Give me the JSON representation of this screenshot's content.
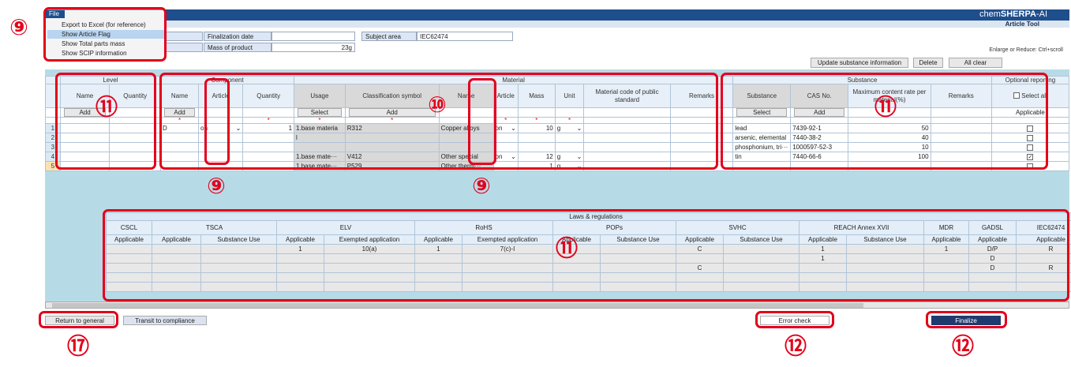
{
  "menu": {
    "file_label": "File",
    "items": [
      "Export to Excel (for reference)",
      "Show Article Flag",
      "Show Total parts mass",
      "Show SCIP information"
    ],
    "highlighted_index": 1
  },
  "header": {
    "logo": "chemSHERPA-AI",
    "logo_prefix": "chem",
    "logo_main": "SHERPA",
    "logo_suffix": "-AI",
    "tool_title": "Article Tool",
    "finalization_date_label": "Finalization date",
    "finalization_date_value": "",
    "subject_area_label": "Subject area",
    "subject_area_value": "IEC62474",
    "mass_label": "Mass of product",
    "mass_value": "23g",
    "enlarge_hint": "Enlarge or Reduce: Ctrl+scroll"
  },
  "toolbar": {
    "update_label": "Update substance information",
    "delete_label": "Delete",
    "allclear_label": "All clear"
  },
  "grid": {
    "group_headers": {
      "level": "Level",
      "component": "Component",
      "material": "Material",
      "substance": "Substance",
      "optional": "Optional reporting"
    },
    "columns": {
      "level_name": "Name",
      "level_qty": "Quantity",
      "comp_name": "Name",
      "comp_article": "Article",
      "comp_qty": "Quantity",
      "usage": "Usage",
      "class_symbol": "Classification symbol",
      "mat_name": "Name",
      "mat_article": "Article",
      "mass": "Mass",
      "unit": "Unit",
      "mat_code": "Material code of public standard",
      "mat_remarks": "Remarks",
      "substance": "Substance",
      "cas": "CAS No.",
      "max_rate": "Maximum content rate per material(%)",
      "sub_remarks": "Remarks",
      "select_all": "Select all"
    },
    "buttons": {
      "add": "Add",
      "select": "Select",
      "applicable": "Applicable"
    },
    "rows": [
      {
        "num": "1",
        "comp_name": "D",
        "comp_article": "on",
        "comp_qty": "1",
        "usage": "1.base materia",
        "class": "R312",
        "mat_name": "Copper alloys",
        "mat_article": "on",
        "mass": "10",
        "unit": "g",
        "substance": "lead",
        "cas": "7439-92-1",
        "rate": "50",
        "checked": false
      },
      {
        "num": "2",
        "comp_name": "",
        "comp_article": "",
        "comp_qty": "",
        "usage": "l",
        "class": "",
        "mat_name": "",
        "mat_article": "",
        "mass": "",
        "unit": "",
        "substance": "arsenic, elemental",
        "cas": "7440-38-2",
        "rate": "40",
        "checked": false
      },
      {
        "num": "3",
        "comp_name": "",
        "comp_article": "",
        "comp_qty": "",
        "usage": "",
        "class": "",
        "mat_name": "",
        "mat_article": "",
        "mass": "",
        "unit": "",
        "substance": "phosphonium, tri···",
        "cas": "1000597-52-3",
        "rate": "10",
        "checked": false
      },
      {
        "num": "4",
        "comp_name": "",
        "comp_article": "",
        "comp_qty": "",
        "usage": "1.base mate···",
        "class": "V412",
        "mat_name": "Other special",
        "mat_article": "on",
        "mass": "12",
        "unit": "g",
        "substance": "tin",
        "cas": "7440-66-6",
        "rate": "100",
        "checked": true
      },
      {
        "num": "5",
        "comp_name": "",
        "comp_article": "",
        "comp_qty": "",
        "usage": "1.base mate···",
        "class": "P529",
        "mat_name": "Other therm···",
        "mat_article": "",
        "mass": "1",
        "unit": "g",
        "substance": "",
        "cas": "",
        "rate": "",
        "checked": false
      }
    ]
  },
  "laws": {
    "title": "Laws & regulations",
    "groups": [
      "CSCL",
      "TSCA",
      "ELV",
      "RoHS",
      "POPs",
      "SVHC",
      "REACH Annex XVII",
      "MDR",
      "GADSL",
      "IEC62474"
    ],
    "subheaders": [
      "Applicable",
      "Applicable",
      "Substance Use",
      "Applicable",
      "Exempted application",
      "Applicable",
      "Exempted application",
      "Applicable",
      "Substance Use",
      "Applicable",
      "Substance Use",
      "Applicable",
      "Substance Use",
      "Applicable",
      "Applicable",
      "Applicable"
    ],
    "rows": [
      [
        "",
        "",
        "",
        "1",
        "10(a)",
        "1",
        "7(c)-I",
        "",
        "",
        "C",
        "",
        "1",
        "",
        "1",
        "D/P",
        "R"
      ],
      [
        "",
        "",
        "",
        "",
        "",
        "",
        "",
        "",
        "",
        "",
        "",
        "1",
        "",
        "",
        "D",
        ""
      ],
      [
        "",
        "",
        "",
        "",
        "",
        "",
        "",
        "",
        "",
        "C",
        "",
        "",
        "",
        "",
        "D",
        "R"
      ],
      [
        "",
        "",
        "",
        "",
        "",
        "",
        "",
        "",
        "",
        "",
        "",
        "",
        "",
        "",
        "",
        ""
      ],
      [
        "",
        "",
        "",
        "",
        "",
        "",
        "",
        "",
        "",
        "",
        "",
        "",
        "",
        "",
        "",
        ""
      ]
    ]
  },
  "bottom": {
    "return_label": "Return to general",
    "transit_label": "Transit to compliance",
    "error_check_label": "Error check",
    "finalize_label": "Finalize"
  },
  "annotations": {
    "n9": "⑨",
    "n10": "⑩",
    "n11": "⑪",
    "n12": "⑫",
    "n17": "⑰"
  },
  "colors": {
    "accent": "#1f4e8c",
    "highlight": "#e3001b",
    "grid_bg": "#b7dbe6"
  }
}
